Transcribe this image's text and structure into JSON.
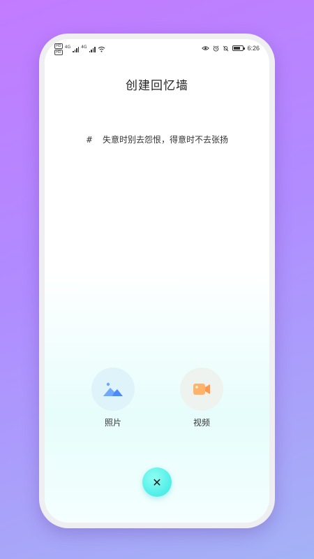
{
  "status_bar": {
    "sim1": "HD",
    "sim2": "HD",
    "net1": "4G",
    "net2": "4G",
    "time": "6:26",
    "battery_level": 0.75
  },
  "page": {
    "title": "创建回忆墙",
    "quote_hash": "#",
    "quote_text": "失意时别去怨恨，得意时不去张扬"
  },
  "actions": [
    {
      "label": "照片",
      "icon": "landscape-image-icon",
      "color": "#4a8cf7"
    },
    {
      "label": "视频",
      "icon": "video-camera-icon",
      "color": "#ff9a4d"
    }
  ],
  "close_button": {
    "glyph": "✕",
    "icon": "close-icon"
  },
  "colors": {
    "background_top": "#c27bff",
    "background_bottom": "#a4b2f6",
    "accent_cyan": "#57f0ea"
  }
}
